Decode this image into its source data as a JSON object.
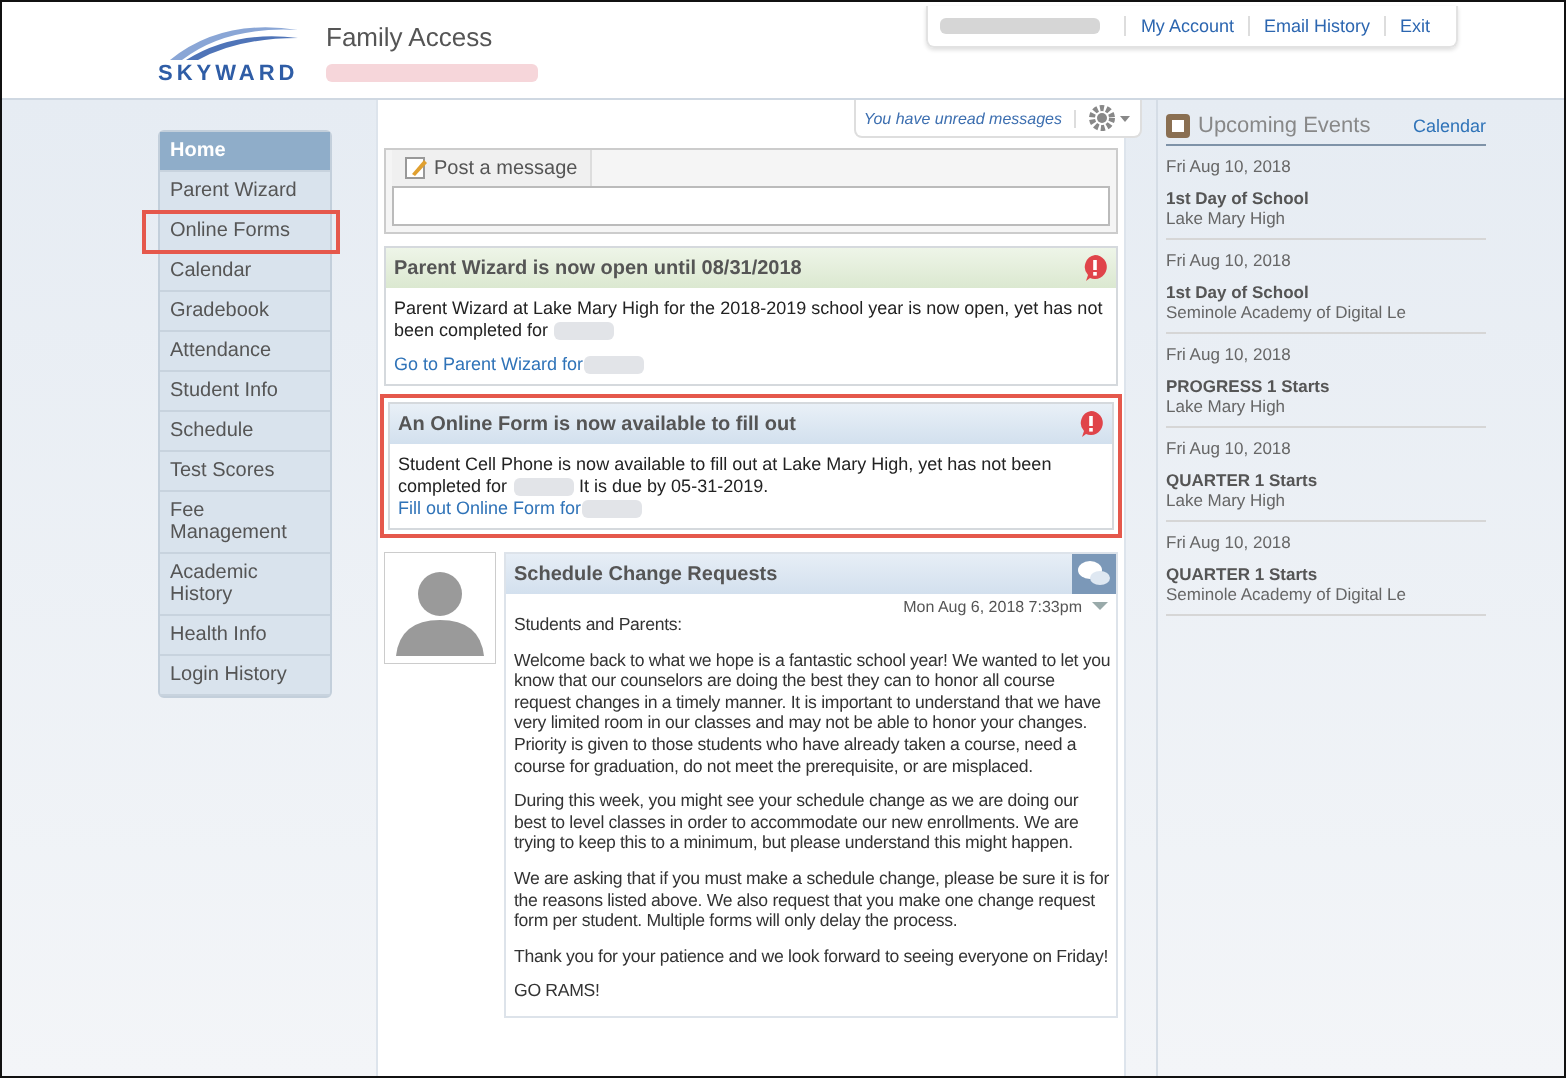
{
  "header": {
    "logo_text": "SKYWARD",
    "title": "Family Access",
    "links": [
      "My Account",
      "Email History",
      "Exit"
    ]
  },
  "toolbar": {
    "unread": "You have unread messages"
  },
  "sidebar": {
    "items": [
      {
        "label": "Home",
        "selected": true,
        "highlighted": false
      },
      {
        "label": "Parent Wizard",
        "selected": false,
        "highlighted": false
      },
      {
        "label": "Online Forms",
        "selected": false,
        "highlighted": true
      },
      {
        "label": "Calendar",
        "selected": false,
        "highlighted": false
      },
      {
        "label": "Gradebook",
        "selected": false,
        "highlighted": false
      },
      {
        "label": "Attendance",
        "selected": false,
        "highlighted": false
      },
      {
        "label": "Student Info",
        "selected": false,
        "highlighted": false
      },
      {
        "label": "Schedule",
        "selected": false,
        "highlighted": false
      },
      {
        "label": "Test Scores",
        "selected": false,
        "highlighted": false
      },
      {
        "label": "Fee Management",
        "selected": false,
        "highlighted": false
      },
      {
        "label": "Academic History",
        "selected": false,
        "highlighted": false
      },
      {
        "label": "Health Info",
        "selected": false,
        "highlighted": false
      },
      {
        "label": "Login History",
        "selected": false,
        "highlighted": false
      }
    ]
  },
  "post": {
    "label": "Post a message"
  },
  "notices": [
    {
      "kind": "wizard",
      "highlighted": false,
      "title": "Parent Wizard is now open until 08/31/2018",
      "lines": [
        "Parent Wizard at Lake Mary High for the 2018-2019 school year is now open, yet has not"
      ],
      "last_line": "been completed for",
      "link": "Go to Parent Wizard for"
    },
    {
      "kind": "form",
      "highlighted": true,
      "title": "An Online Form is now available to fill out",
      "lines": [
        "Student Cell Phone is now available to fill out at Lake Mary High, yet has not been"
      ],
      "last_line": "completed for",
      "after": "It is due by 05-31-2019.",
      "link": "Fill out Online Form for"
    }
  ],
  "message": {
    "title": "Schedule Change Requests",
    "timestamp": "Mon Aug 6, 2018 7:33pm",
    "paragraphs": [
      "Students and Parents:",
      "Welcome back to what we hope is a fantastic school year! We wanted to let you know that our counselors are doing the best they can to honor all course request changes in a timely manner. It is important to understand that we have very limited room in our classes and may not be able to honor your changes. Priority is given to those students who have already taken a course, need a course for graduation, do not meet the prerequisite, or are misplaced.",
      "During this week, you might see your schedule change as we are doing our best to level classes in order to accommodate our new enrollments. We are trying to keep this to a minimum, but please understand this might happen.",
      "We are asking that if you must make a schedule change, please be sure it is for the reasons listed above. We also request that you make one change request form per student. Multiple forms will only delay the process.",
      "Thank you for your patience and we look forward to seeing everyone on Friday!",
      "GO RAMS!"
    ]
  },
  "events": {
    "title": "Upcoming Events",
    "calendar_link": "Calendar",
    "items": [
      {
        "date": "Fri Aug 10, 2018",
        "title": "1st Day of School",
        "place": "Lake Mary High"
      },
      {
        "date": "Fri Aug 10, 2018",
        "title": "1st Day of School",
        "place": "Seminole Academy of Digital Le"
      },
      {
        "date": "Fri Aug 10, 2018",
        "title": "PROGRESS 1 Starts",
        "place": "Lake Mary High"
      },
      {
        "date": "Fri Aug 10, 2018",
        "title": "QUARTER 1 Starts",
        "place": "Lake Mary High"
      },
      {
        "date": "Fri Aug 10, 2018",
        "title": "QUARTER 1 Starts",
        "place": "Seminole Academy of Digital Le"
      }
    ]
  }
}
